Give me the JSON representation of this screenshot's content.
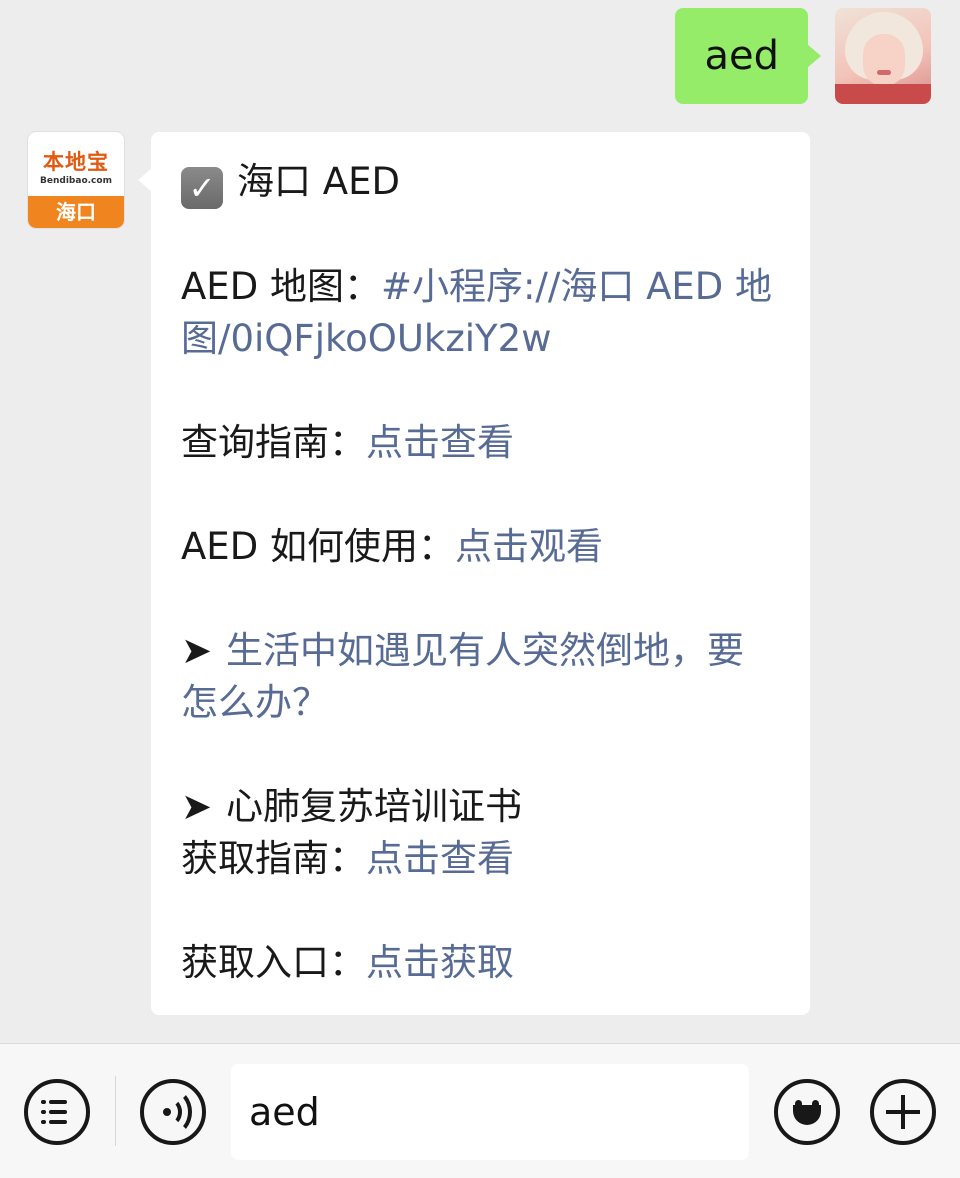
{
  "outgoing": {
    "text": "aed"
  },
  "account": {
    "brand_name": "本地宝",
    "brand_domain": "Bendibao.com",
    "brand_city": "海口"
  },
  "incoming": {
    "title": "海口 AED",
    "map_label": "AED 地图：",
    "map_link": "#小程序://海口 AED 地图/0iQFjkoOUkziY2w",
    "guide_label": "查询指南：",
    "guide_link": "点击查看",
    "usage_label": "AED 如何使用：",
    "usage_link": "点击观看",
    "arrow": "➤",
    "emergency_link": "生活中如遇见有人突然倒地，要怎么办？",
    "cert_title": "心肺复苏培训证书",
    "cert_guide_label": "获取指南：",
    "cert_guide_link": "点击查看",
    "cert_entry_label": "获取入口：",
    "cert_entry_link": "点击获取"
  },
  "input_bar": {
    "value": "aed"
  },
  "icons": {
    "menu": "menu-icon",
    "voice": "voice-icon",
    "emoji": "emoji-icon",
    "plus": "plus-icon",
    "check": "checkbox-icon"
  },
  "colors": {
    "outgoing_bubble": "#95ec69",
    "link": "#576b95",
    "background": "#ededed"
  }
}
